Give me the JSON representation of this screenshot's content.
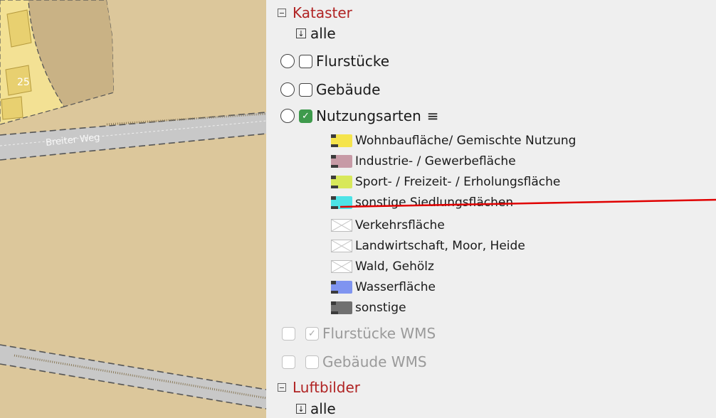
{
  "map": {
    "street_label": "Breiter Weg",
    "house_number": "25"
  },
  "kataster": {
    "title": "Kataster",
    "all_label": "alle",
    "layers": [
      {
        "label": "Flurstücke",
        "checked": false
      },
      {
        "label": "Gebäude",
        "checked": false
      },
      {
        "label": "Nutzungsarten",
        "checked": true,
        "menu_icon": "hamburger-menu-icon"
      }
    ],
    "legend": [
      {
        "label": "Wohnbaufläche/ Gemischte Nutzung",
        "color": "#f5e44c"
      },
      {
        "label": "Industrie- / Gewerbefläche",
        "color": "#c79aa6"
      },
      {
        "label": "Sport- / Freizeit- / Erholungsfläche",
        "color": "#d8e85a"
      },
      {
        "label": "sonstige Siedlungsflächen",
        "color": "#4de3e6"
      },
      {
        "label": "Verkehrsfläche",
        "color": "none"
      },
      {
        "label": "Landwirtschaft, Moor, Heide",
        "color": "none"
      },
      {
        "label": "Wald, Gehölz",
        "color": "none"
      },
      {
        "label": "Wasserfläche",
        "color": "#7f94f0"
      },
      {
        "label": "sonstige",
        "color": "#707070"
      }
    ],
    "wms_layers": [
      {
        "label": "Flurstücke WMS",
        "checked": true,
        "disabled": true
      },
      {
        "label": "Gebäude WMS",
        "checked": false,
        "disabled": true
      }
    ]
  },
  "luftbilder": {
    "title": "Luftbilder",
    "all_label": "alle"
  },
  "colors": {
    "group_title": "#b02323",
    "checked": "#3e9a4c",
    "annotation_line": "#e00000"
  }
}
